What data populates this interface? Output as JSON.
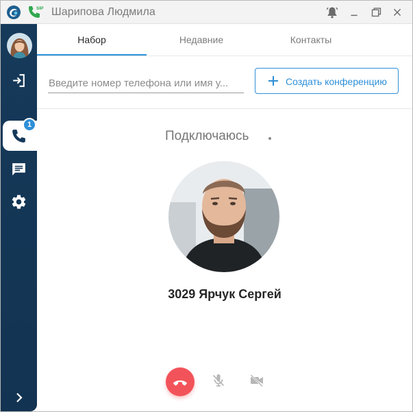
{
  "window": {
    "title": "Шарипова Людмила",
    "sip_badge": "SIP"
  },
  "sidebar": {
    "call_badge_count": "1"
  },
  "tabs": [
    {
      "label": "Набор",
      "active": true
    },
    {
      "label": "Недавние",
      "active": false
    },
    {
      "label": "Контакты",
      "active": false
    }
  ],
  "dialer": {
    "search_placeholder": "Введите номер телефона или имя у...",
    "search_value": "",
    "create_conference_label": "Создать конференцию"
  },
  "call": {
    "status": "Подключаюсь",
    "contact_name": "3029 Ярчук Сергей"
  },
  "colors": {
    "accent": "#2d8fd8",
    "sidebar_bg": "#163a5a",
    "hangup": "#f2535a",
    "sip_green": "#2fa84f"
  },
  "icons": {
    "app_logo": "app-logo-icon",
    "sip_phone": "sip-phone-icon",
    "notifications": "bell-icon",
    "minimize": "minimize-icon",
    "maximize": "maximize-icon",
    "close": "close-icon",
    "logout": "logout-icon",
    "calls": "phone-icon",
    "chat": "chat-icon",
    "settings": "gear-icon",
    "expand": "chevron-right-icon",
    "add": "plus-icon",
    "hangup": "hangup-icon",
    "mic": "mic-off-icon",
    "video": "video-off-icon"
  }
}
